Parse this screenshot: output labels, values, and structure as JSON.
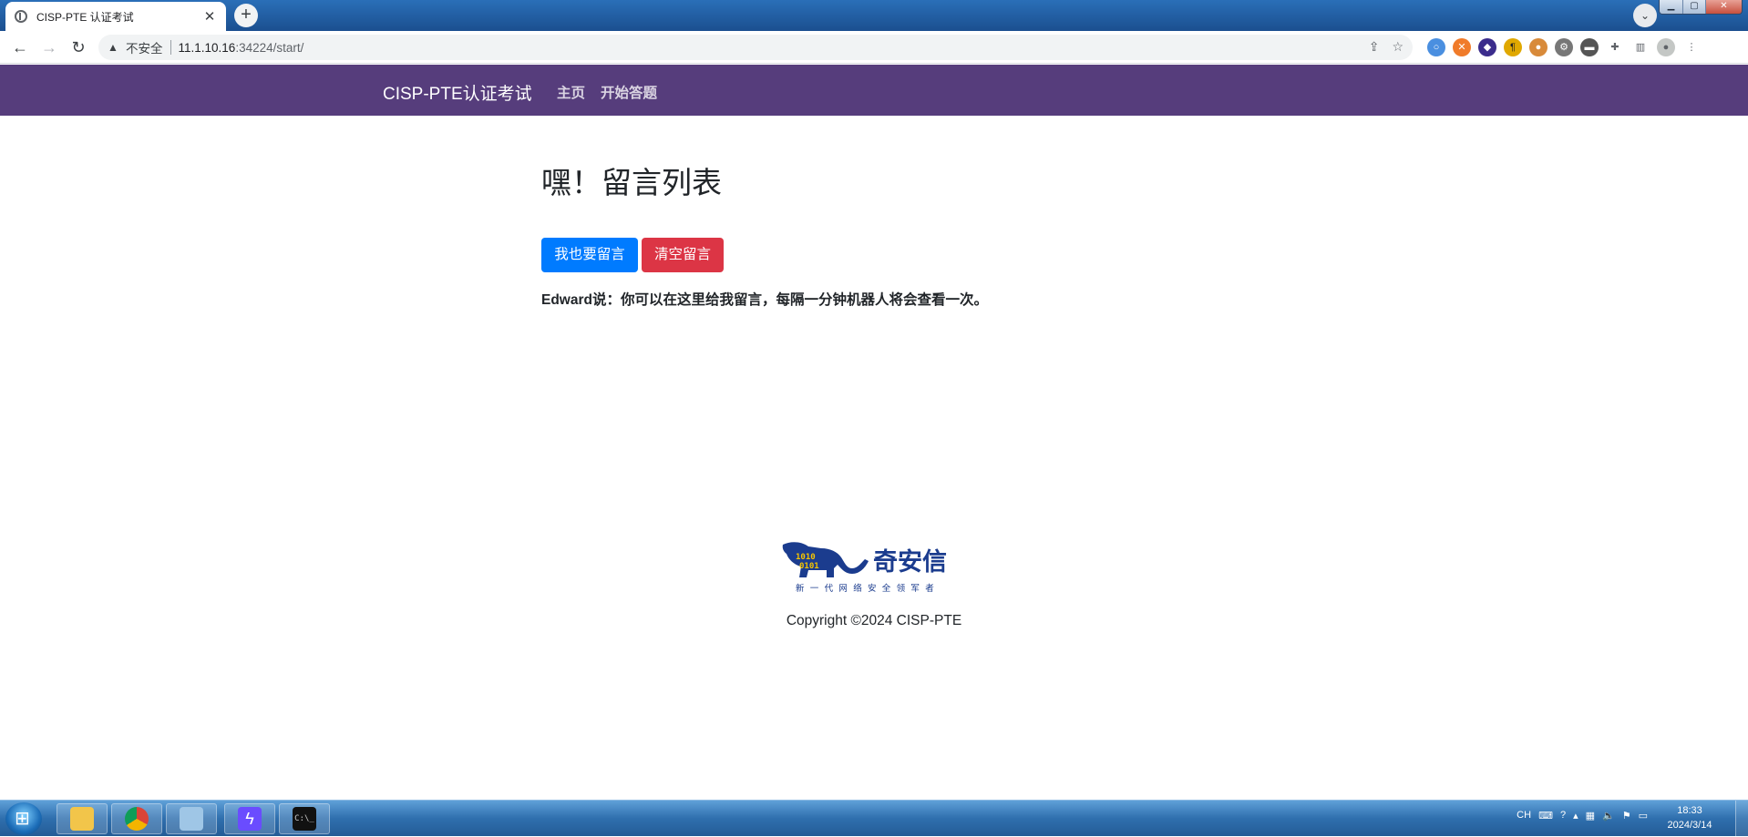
{
  "browser": {
    "tab_title": "CISP-PTE 认证考试",
    "tab_close": "✕",
    "newtab_label": "+",
    "insecure_label": "不安全",
    "url_host": "11.1.10.16",
    "url_rest": ":34224/start/"
  },
  "site": {
    "brand": "CISP-PTE认证考试",
    "nav": [
      {
        "label": "主页"
      },
      {
        "label": "开始答题"
      }
    ],
    "heading": "嘿！留言列表",
    "buttons": {
      "leave_message": "我也要留言",
      "clear_messages": "清空留言"
    },
    "message": "Edward说：你可以在这里给我留言，每隔一分钟机器人将会查看一次。",
    "logo": {
      "name": "奇安信",
      "slogan": "新一代网络安全领军者",
      "binary": "1010 0101"
    },
    "copyright": "Copyright ©2024 CISP-PTE"
  },
  "taskbar": {
    "lang": "CH",
    "time": "18:33",
    "date": "2024/3/14"
  },
  "colors": {
    "navbar": "#563d7c",
    "primary": "#007bff",
    "danger": "#dc3545",
    "logo_blue": "#1b3c8e",
    "logo_yellow": "#f5c400"
  }
}
